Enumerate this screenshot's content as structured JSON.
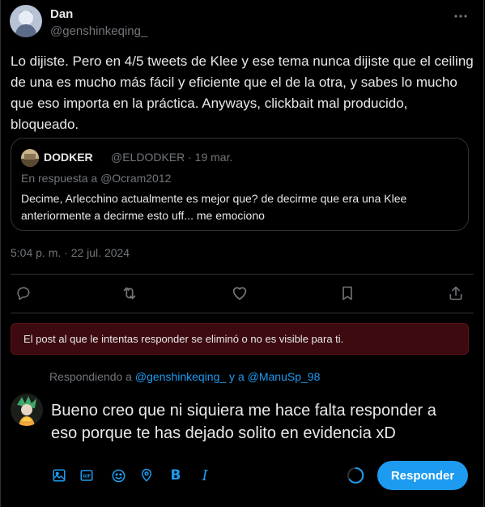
{
  "colors": {
    "accent": "#1d9bf0",
    "muted": "#71767b",
    "alert_bg": "#3d0a0f"
  },
  "tweet": {
    "author_name": "Dan",
    "author_handle": "@genshinkeqing_",
    "text": "Lo dijiste. Pero en 4/5 tweets de Klee y ese tema nunca dijiste que el ceiling de una es mucho más fácil y eficiente que el de la otra, y sabes lo mucho que eso importa en la práctica. Anyways, clickbait mal producido, bloqueado.",
    "timestamp": "5:04 p. m. · 22 jul. 2024",
    "more_icon": "more-horizontal-icon"
  },
  "quote": {
    "author_name": "DODKER",
    "author_meta": "@ELDODKER · 19 mar.",
    "reply_prefix": "En respuesta a ",
    "reply_to": "@Ocram2012",
    "text": "Decime, Arlecchino actualmente es mejor que? de decirme que era una Klee anteriormente a decirme esto uff... me emociono"
  },
  "actions": [
    "reply-icon",
    "retweet-icon",
    "like-icon",
    "bookmark-icon",
    "share-icon"
  ],
  "alert": {
    "text": "El post al que le intentas responder se eliminó o no es visible para ti."
  },
  "compose": {
    "replying_prefix": "Respondiendo a ",
    "mention1": "@genshinkeqing_",
    "and_text": " y a ",
    "mention2": "@ManuSp_98",
    "text": "Bueno creo que ni siquiera me hace falta responder a eso porque te has dejado solito en evidencia xD",
    "toolbar": [
      "image-icon",
      "gif-icon",
      "emoji-icon",
      "location-icon",
      "bold-icon",
      "italic-icon"
    ],
    "reply_label": "Responder"
  }
}
